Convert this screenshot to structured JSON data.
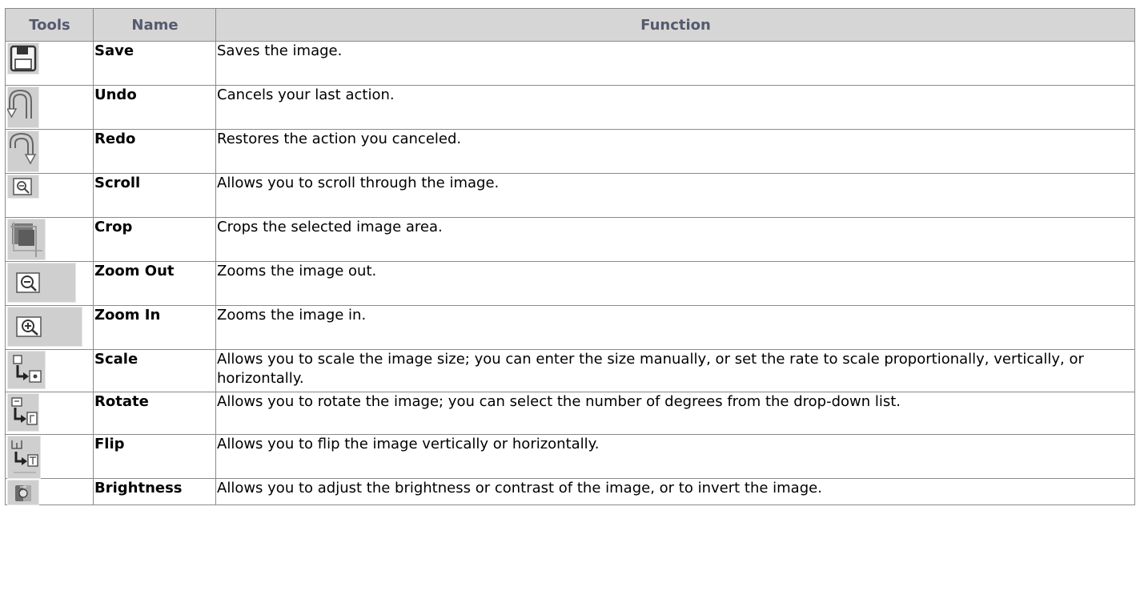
{
  "table": {
    "headers": {
      "tools": "Tools",
      "name": "Name",
      "function": "Function"
    },
    "rows": [
      {
        "icon": "save-icon",
        "name": "Save",
        "function": "Saves the image."
      },
      {
        "icon": "undo-icon",
        "name": "Undo",
        "function": "Cancels your last action."
      },
      {
        "icon": "redo-icon",
        "name": "Redo",
        "function": "Restores the action you canceled."
      },
      {
        "icon": "scroll-icon",
        "name": "Scroll",
        "function": "Allows you to scroll through the image."
      },
      {
        "icon": "crop-icon",
        "name": "Crop",
        "function": "Crops the selected image area."
      },
      {
        "icon": "zoom-out-icon",
        "name": "Zoom Out",
        "function": "Zooms the image out."
      },
      {
        "icon": "zoom-in-icon",
        "name": "Zoom In",
        "function": "Zooms the image in."
      },
      {
        "icon": "scale-icon",
        "name": "Scale",
        "function": "Allows you to scale the image size; you can enter the size manually, or set the rate to scale proportionally, vertically, or horizontally."
      },
      {
        "icon": "rotate-icon",
        "name": "Rotate",
        "function": "Allows you to rotate the image; you can select the number of degrees from the drop-down list."
      },
      {
        "icon": "flip-icon",
        "name": "Flip",
        "function": "Allows you to flip the image vertically or horizontally."
      },
      {
        "icon": "brightness-icon",
        "name": "Brightness",
        "function": "Allows you to adjust the brightness or contrast of the image, or to invert the image."
      }
    ]
  },
  "colors": {
    "header_bg": "#d6d6d6",
    "header_text": "#555a6e",
    "border": "#8a8a8a",
    "icon_bg": "#cfcfcf"
  }
}
